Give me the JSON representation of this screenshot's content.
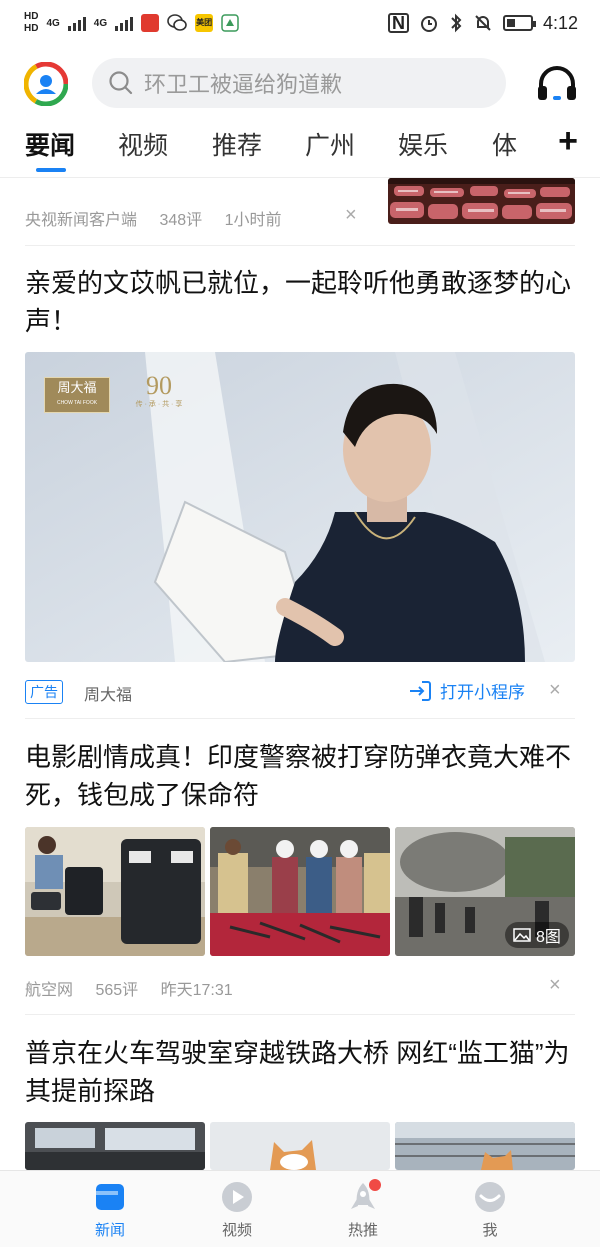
{
  "status_bar": {
    "left_label_1": "HD",
    "left_label_2": "HD",
    "network_1": "4G",
    "network_2": "4G",
    "app_badge": "美团",
    "nfc_label": "N",
    "time": "4:12",
    "battery_level": 0.35
  },
  "header": {
    "search_placeholder": "环卫工被逼给狗道歉"
  },
  "tabs": [
    {
      "label": "要闻",
      "active": true
    },
    {
      "label": "视频"
    },
    {
      "label": "推荐"
    },
    {
      "label": "广州"
    },
    {
      "label": "娱乐"
    },
    {
      "label": "体"
    }
  ],
  "tab_add": "+",
  "feed": {
    "item1": {
      "source": "央视新闻客户端",
      "comments": "348评",
      "time": "1小时前",
      "close": "×"
    },
    "ad": {
      "headline": "亲爱的文苡帆已就位，一起聆听他勇敢逐梦的心声！",
      "brand_logo_text": "周大福",
      "brand_logo_sub": "CHOW TAI FOOK",
      "anniv_number": "90",
      "anniv_sub": "传 · 承 · 共 · 享",
      "tag": "广告",
      "advertiser": "周大福",
      "cta": "打开小程序",
      "close": "×"
    },
    "item2": {
      "headline": "电影剧情成真！印度警察被打穿防弹衣竟大难不死，钱包成了保命符",
      "image_count": "8图",
      "source": "航空网",
      "comments": "565评",
      "time": "昨天17:31",
      "close": "×"
    },
    "item3": {
      "headline": "普京在火车驾驶室穿越铁路大桥 网红“监工猫”为其提前探路"
    }
  },
  "bottom_nav": [
    {
      "label": "新闻",
      "icon": "news-icon",
      "active": true
    },
    {
      "label": "视频",
      "icon": "play-icon"
    },
    {
      "label": "热推",
      "icon": "rocket-icon",
      "has_dot": true
    },
    {
      "label": "我",
      "icon": "profile-icon"
    }
  ],
  "colors": {
    "accent": "#1a82f4",
    "badge_red": "#f04a45",
    "search_bg": "#f0f1f3"
  }
}
